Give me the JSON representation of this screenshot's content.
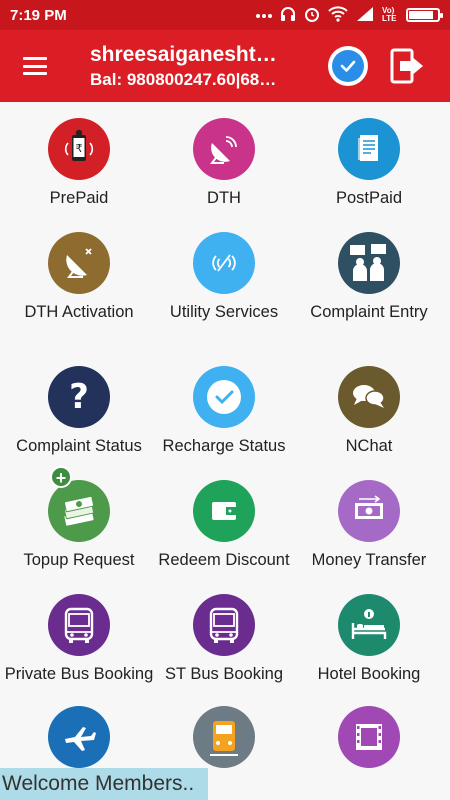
{
  "status_bar": {
    "time": "7:19 PM",
    "icons": [
      "more-dots-icon",
      "headset-icon",
      "alarm-icon",
      "wifi-icon",
      "signal-icon",
      "volte-icon",
      "battery-icon"
    ],
    "volte_label": "Vo) LTE",
    "battery_level": 0.85
  },
  "app_bar": {
    "title": "shreesaiganesht…",
    "balance": "Bal: 980800247.60|68…",
    "colors": {
      "primary": "#db1d25",
      "status": "#c8161d",
      "verify": "#2a8ee9"
    }
  },
  "tiles": [
    {
      "label": "PrePaid",
      "icon": "mobile-recharge-icon",
      "color": "#d32027"
    },
    {
      "label": "DTH",
      "icon": "satellite-dish-icon",
      "color": "#c9348a"
    },
    {
      "label": "PostPaid",
      "icon": "bill-document-icon",
      "color": "#1c93d2"
    },
    {
      "label": "DTH Activation",
      "icon": "dish-activation-icon",
      "color": "#8e6b2f"
    },
    {
      "label": "Utility Services",
      "icon": "wireless-signal-icon",
      "color": "#3fb1f0"
    },
    {
      "label": "Complaint Entry",
      "icon": "complaint-people-icon",
      "color": "#2f4f63"
    },
    {
      "label": "Complaint Status",
      "icon": "question-mark-icon",
      "color": "#22325a"
    },
    {
      "label": "Recharge Status",
      "icon": "checkmark-icon",
      "color": "#3fb1f0"
    },
    {
      "label": "NChat",
      "icon": "chat-bubbles-icon",
      "color": "#6b5a2e"
    },
    {
      "label": "Topup Request",
      "icon": "money-stack-icon",
      "color": "#4e9a4b"
    },
    {
      "label": "Redeem Discount",
      "icon": "wallet-icon",
      "color": "#1fa25a"
    },
    {
      "label": "Money Transfer",
      "icon": "cash-transfer-icon",
      "color": "#a56ac5"
    },
    {
      "label": "Private Bus Booking",
      "icon": "bus-icon",
      "color": "#6a2c8e"
    },
    {
      "label": "ST Bus Booking",
      "icon": "bus-icon",
      "color": "#6a2c8e"
    },
    {
      "label": "Hotel Booking",
      "icon": "hotel-bed-icon",
      "color": "#1e8a6d"
    },
    {
      "label": "",
      "icon": "airplane-icon",
      "color": "#1a6fb6"
    },
    {
      "label": "",
      "icon": "train-icon",
      "color": "#6d7b84"
    },
    {
      "label": "",
      "icon": "film-icon",
      "color": "#a049b5"
    }
  ],
  "marquee": {
    "text": "Welcome Members.."
  }
}
